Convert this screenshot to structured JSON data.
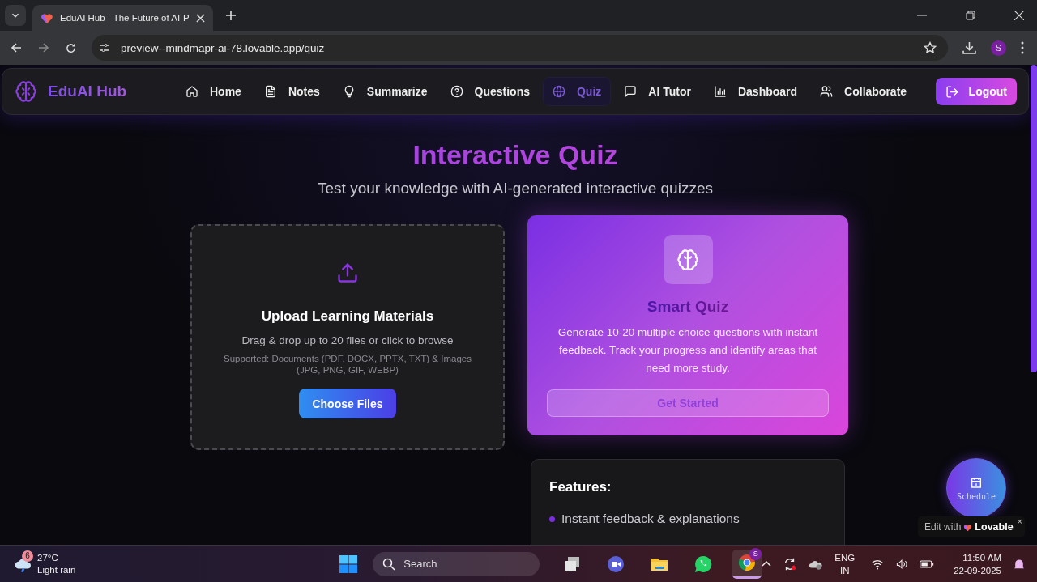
{
  "browser": {
    "tab_title": "EduAI Hub - The Future of AI-P",
    "url": "preview--mindmapr-ai-78.lovable.app/quiz",
    "avatar": "S"
  },
  "navbar": {
    "brand": "EduAI Hub",
    "items": [
      {
        "label": "Home",
        "kind": "home",
        "selected": false
      },
      {
        "label": "Notes",
        "kind": "file",
        "selected": false
      },
      {
        "label": "Summarize",
        "kind": "bulb",
        "selected": false
      },
      {
        "label": "Questions",
        "kind": "help",
        "selected": false
      },
      {
        "label": "Quiz",
        "kind": "globe",
        "selected": true
      },
      {
        "label": "AI Tutor",
        "kind": "chat",
        "selected": false
      },
      {
        "label": "Dashboard",
        "kind": "chart",
        "selected": false
      },
      {
        "label": "Collaborate",
        "kind": "users",
        "selected": false
      }
    ],
    "logout": "Logout"
  },
  "page": {
    "title": "Interactive Quiz",
    "subtitle": "Test your knowledge with AI-generated interactive quizzes"
  },
  "upload": {
    "title": "Upload Learning Materials",
    "hint": "Drag & drop up to 20 files or click to browse",
    "supported": "Supported: Documents (PDF, DOCX, PPTX, TXT) & Images (JPG, PNG, GIF, WEBP)",
    "button": "Choose Files"
  },
  "quiz_card": {
    "title": "Smart Quiz",
    "description": "Generate 10-20 multiple choice questions with instant feedback. Track your progress and identify areas that need more study.",
    "button": "Get Started"
  },
  "features": {
    "title": "Features:",
    "items": [
      "Instant feedback & explanations"
    ]
  },
  "schedule_button": {
    "label": "Schedule"
  },
  "lovable_badge": {
    "prefix": "Edit with",
    "brand": "Lovable",
    "close": "×"
  },
  "taskbar": {
    "weather": {
      "badge": "6",
      "temp": "27°C",
      "condition": "Light rain"
    },
    "search": {
      "placeholder": "Search"
    },
    "apps": [
      {
        "kind": "task-view",
        "active": false
      },
      {
        "kind": "meet",
        "active": false
      },
      {
        "kind": "files",
        "active": false
      },
      {
        "kind": "whatsapp",
        "active": false
      },
      {
        "kind": "chrome",
        "active": true,
        "badge": "S"
      }
    ],
    "lang": "ENG",
    "region": "IN",
    "time": "11:50 AM",
    "date": "22-09-2025"
  }
}
